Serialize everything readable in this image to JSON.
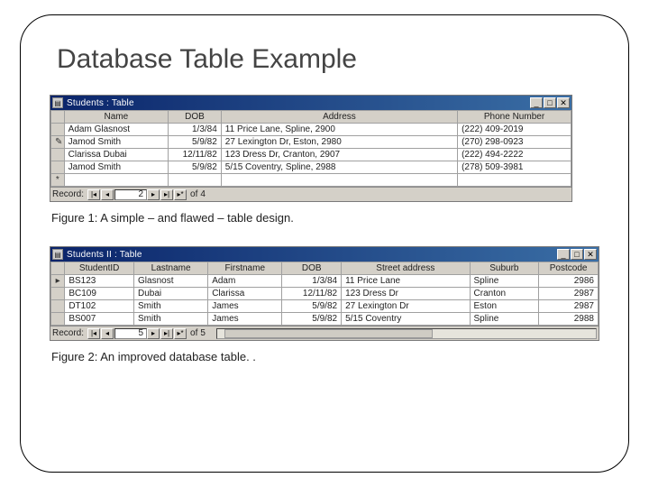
{
  "title": "Database Table Example",
  "figure1": {
    "caption": "Figure 1: A simple – and flawed – table design.",
    "window_title": "Students : Table",
    "columns": [
      "Name",
      "DOB",
      "Address",
      "Phone Number"
    ],
    "rows": [
      {
        "marker": "",
        "name": "Adam Glasnost",
        "dob": "1/3/84",
        "address": "11 Price Lane, Spline, 2900",
        "phone": "(222) 409-2019"
      },
      {
        "marker": "✎",
        "name": "Jamod Smith",
        "dob": "5/9/82",
        "address": "27 Lexington Dr, Eston, 2980",
        "phone": "(270) 298-0923"
      },
      {
        "marker": "",
        "name": "Clarissa Dubai",
        "dob": "12/11/82",
        "address": "123 Dress Dr, Cranton, 2907",
        "phone": "(222) 494-2222"
      },
      {
        "marker": "",
        "name": "Jamod Smith",
        "dob": "5/9/82",
        "address": "5/15 Coventry, Spline, 2988",
        "phone": "(278) 509-3981"
      },
      {
        "marker": "*",
        "name": "",
        "dob": "",
        "address": "",
        "phone": ""
      }
    ],
    "nav": {
      "label": "Record:",
      "current": "2",
      "of_label": "of",
      "total": "4"
    }
  },
  "figure2": {
    "caption": "Figure 2: An improved database table. .",
    "window_title": "Students II : Table",
    "columns": [
      "StudentID",
      "Lastname",
      "Firstname",
      "DOB",
      "Street address",
      "Suburb",
      "Postcode"
    ],
    "rows": [
      {
        "marker": "▸",
        "id": "BS123",
        "last": "Glasnost",
        "first": "Adam",
        "dob": "1/3/84",
        "street": "11 Price Lane",
        "suburb": "Spline",
        "post": "2986"
      },
      {
        "marker": "",
        "id": "BC109",
        "last": "Dubai",
        "first": "Clarissa",
        "dob": "12/11/82",
        "street": "123 Dress Dr",
        "suburb": "Cranton",
        "post": "2987"
      },
      {
        "marker": "",
        "id": "DT102",
        "last": "Smith",
        "first": "James",
        "dob": "5/9/82",
        "street": "27 Lexington Dr",
        "suburb": "Eston",
        "post": "2987"
      },
      {
        "marker": "",
        "id": "BS007",
        "last": "Smith",
        "first": "James",
        "dob": "5/9/82",
        "street": "5/15 Coventry",
        "suburb": "Spline",
        "post": "2988"
      }
    ],
    "nav": {
      "label": "Record:",
      "current": "5",
      "of_label": "of",
      "total": "5"
    }
  },
  "winbuttons": {
    "min": "_",
    "max": "□",
    "close": "✕"
  },
  "navglyphs": {
    "first": "|◂",
    "prev": "◂",
    "next": "▸",
    "last": "▸|",
    "new": "▸*"
  }
}
